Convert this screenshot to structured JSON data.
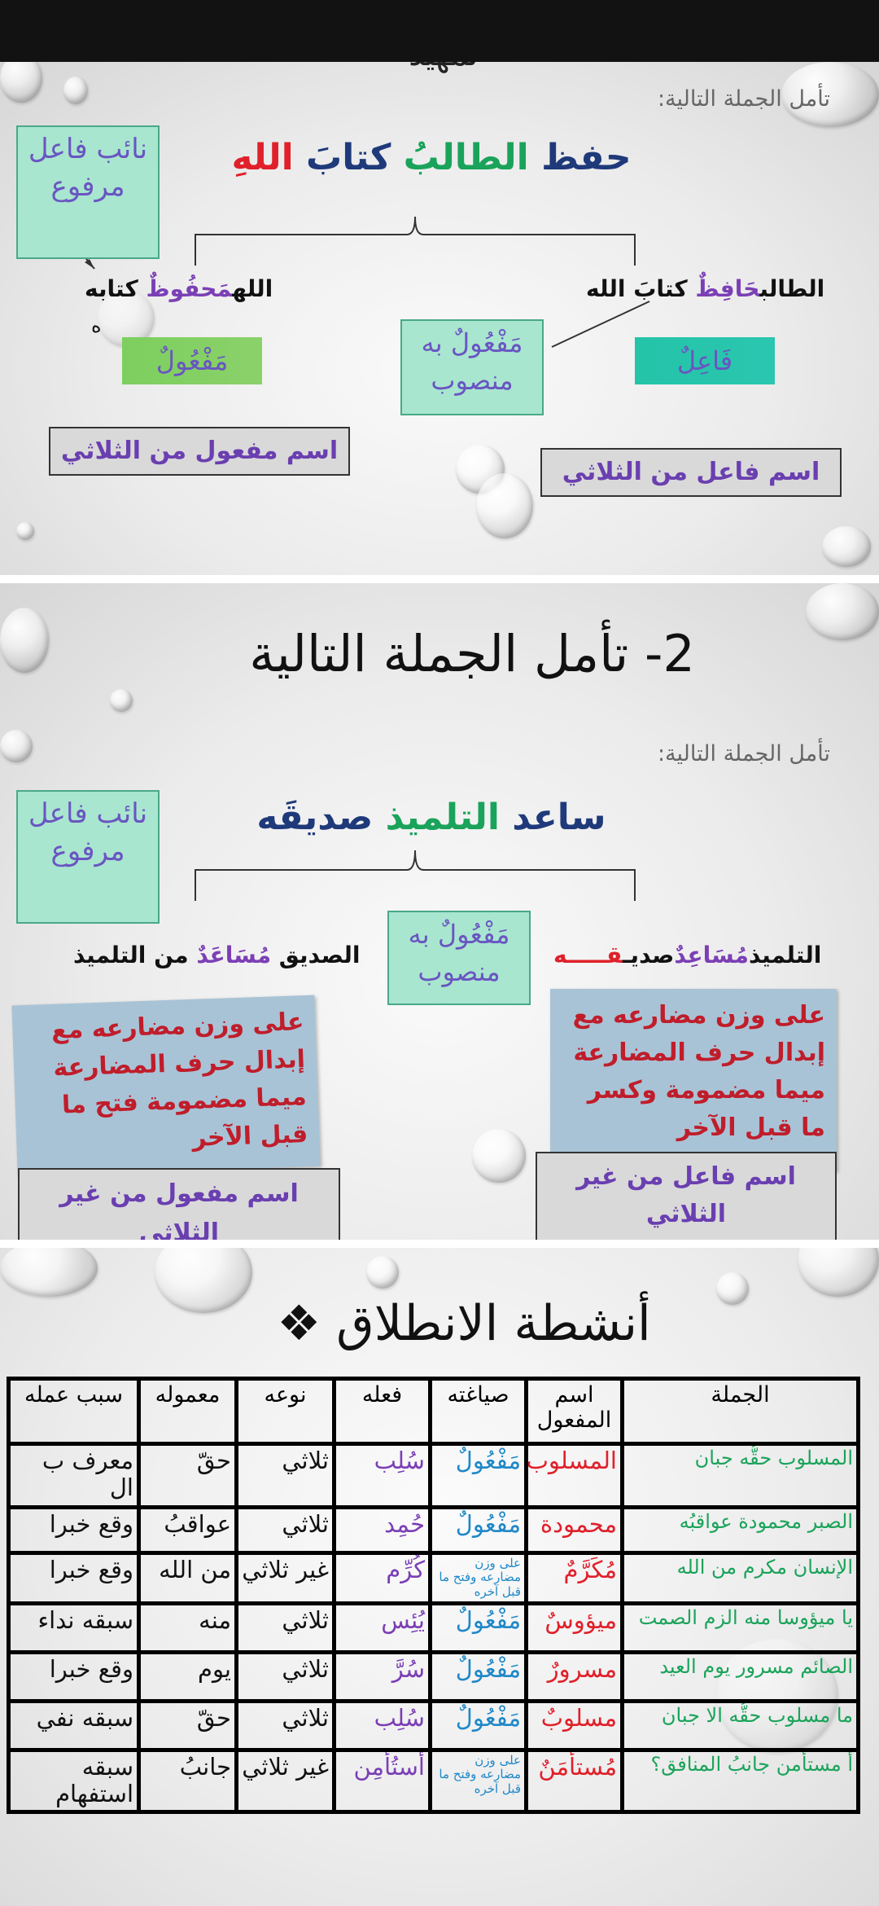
{
  "slide1": {
    "top_title": "تمهيد",
    "subtitle": "تأمل الجملة التالية:",
    "sentence": {
      "w1": "حفظ",
      "w2": "الطالبُ",
      "w3": "كتابَ",
      "w4": "اللهِ"
    },
    "left_box": "نائب فاعل مرفوع",
    "right_line": {
      "a": "الطالب",
      "b": "حَافِظٌ",
      "c": "كتابَ الله"
    },
    "left_line": {
      "a": "الله",
      "b": "مَحفُوظٌ",
      "c": "كتابه"
    },
    "left_line_extra": "ه",
    "mid_box": "مَفْعُولٌ به منصوب",
    "fa3il_box": "فَاعِلٌ",
    "maf3ool_box": "مَفْعُولٌ",
    "gray_right": "اسم فاعل من الثلاثي",
    "gray_left": "اسم مفعول من الثلاثي"
  },
  "slide2": {
    "title": "2- تأمل الجملة التالية",
    "subtitle": "تأمل الجملة التالية:",
    "sentence": {
      "w1": "ساعد",
      "w2": "التلميذ",
      "w3": "صديقَه"
    },
    "left_box": "نائب فاعل مرفوع",
    "mid_box": "مَفْعُولٌ به منصوب",
    "right_line": {
      "a": "التلميذ",
      "b": "مُسَاعِدٌ",
      "c": "صديـ",
      "d": "قـــــه"
    },
    "left_line": {
      "a": "الصديق",
      "b": "مُسَاعَدٌ",
      "c": "من التلميذ"
    },
    "note_left": "على وزن مضارعه مع إبدال حرف المضارعة ميما مضمومة فتح ما قبل الآخر",
    "note_right": "على وزن مضارعه مع إبدال حرف المضارعة ميما مضمومة وكسر ما قبل الآخر",
    "gray_left": "اسم مفعول من غير الثلاثي",
    "gray_right": "اسم فاعل من غير الثلاثي"
  },
  "slide3": {
    "title": "أنشطة الانطلاق ❖",
    "headers": [
      "الجملة",
      "اسم المفعول",
      "صياغته",
      "فعله",
      "نوعه",
      "معموله",
      "سبب عمله"
    ],
    "rows": [
      {
        "sentence": "المسلوب حقُّه جبان",
        "name": "المسلوب",
        "form": "مَفْعُولٌ",
        "verb": "سُلِب",
        "type": "ثلاثي",
        "ma3mool": "حقّ",
        "reason": "معرف ب ال"
      },
      {
        "sentence": "الصبر محمودة عواقبُه",
        "name": "محمودة",
        "form": "مَفْعُولٌ",
        "verb": "حُمِد",
        "type": "ثلاثي",
        "ma3mool": "عواقبُ",
        "reason": "وقع خبرا"
      },
      {
        "sentence": "الإنسان مكرم من الله",
        "name": "مُكَرَّمٌ",
        "form": "على وزن مضارعه وفتح ما قبل آخره",
        "verb": "كُرِّم",
        "type": "غير ثلاثي",
        "ma3mool": "من الله",
        "reason": "وقع خبرا"
      },
      {
        "sentence": "يا ميؤوسا منه الزم الصمت",
        "name": "ميؤوسٌ",
        "form": "مَفْعُولٌ",
        "verb": "يُئِس",
        "type": "ثلاثي",
        "ma3mool": "منه",
        "reason": "سبقه نداء"
      },
      {
        "sentence": "الصائم مسرور يوم العيد",
        "name": "مسرورٌ",
        "form": "مَفْعُولٌ",
        "verb": "سُرَّ",
        "type": "ثلاثي",
        "ma3mool": "يوم",
        "reason": "وقع خبرا"
      },
      {
        "sentence": "ما مسلوب حقُّه الا جبان",
        "name": "مسلوبٌ",
        "form": "مَفْعُولٌ",
        "verb": "سُلِب",
        "type": "ثلاثي",
        "ma3mool": "حقّ",
        "reason": "سبقه نفي"
      },
      {
        "sentence": "أ مستأمن جانبُ المنافق؟",
        "name": "مُستأمَنٌ",
        "form": "على وزن مضارعه وفتح ما قبل آخره",
        "verb": "أُستُأمِن",
        "type": "غير ثلاثي",
        "ma3mool": "جانبُ",
        "reason": "سبقه استفهام"
      }
    ]
  }
}
